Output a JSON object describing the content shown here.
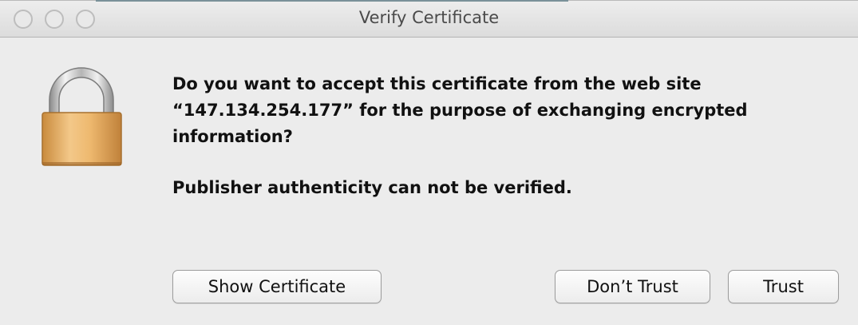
{
  "window": {
    "title": "Verify Certificate"
  },
  "dialog": {
    "lock_icon": "lock-icon",
    "message_line1": "Do you want to accept this certificate from the web site",
    "message_line2": "“147.134.254.177” for the purpose of exchanging encrypted",
    "message_line3": "information?",
    "subtext": "Publisher authenticity can not be verified."
  },
  "buttons": {
    "show_certificate": "Show Certificate",
    "dont_trust": "Don’t Trust",
    "trust": "Trust"
  }
}
